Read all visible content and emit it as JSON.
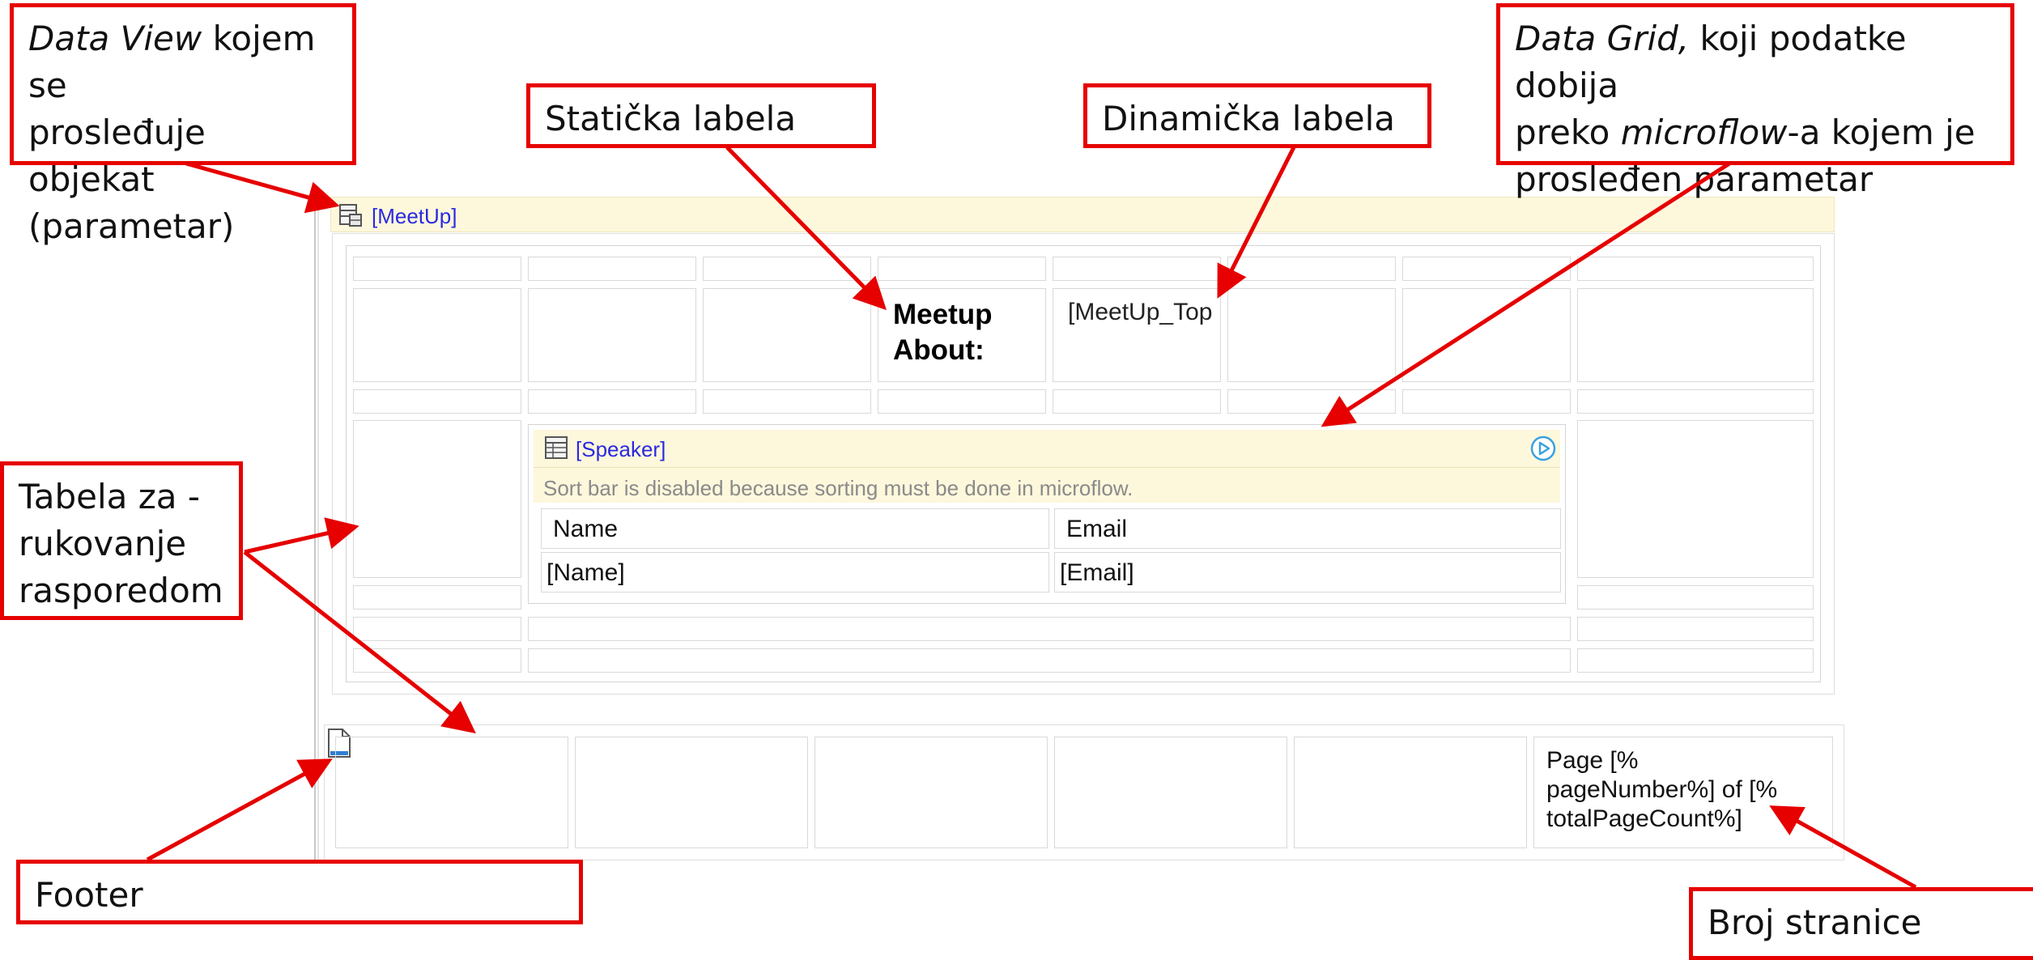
{
  "colors": {
    "callout_border": "#e60000",
    "arrow": "#e60000",
    "header_bg": "#fdf7dc",
    "entity_link": "#2a2ae0"
  },
  "dataview": {
    "entity": "[MeetUp]",
    "icon": "dataview-icon"
  },
  "layout_table": {
    "static_label": "Meetup About:",
    "dynamic_label": "[MeetUp_Topic]"
  },
  "datagrid": {
    "entity": "[Speaker]",
    "icon": "datagrid-icon",
    "run_icon": "play-circle-icon",
    "message": "Sort bar is disabled because sorting must be done in microflow.",
    "columns": [
      "Name",
      "Email"
    ],
    "row": [
      "[Name]",
      "[Email]"
    ]
  },
  "footer": {
    "icon": "page-icon",
    "page_text": "Page [% pageNumber%] of [% totalPageCount%]"
  },
  "callouts": {
    "dataview": {
      "em": "Data View",
      "rest1": " kojem se",
      "line2": "prosleđuje objekat",
      "line3": "(parametar)"
    },
    "static_label": "Statička labela",
    "dynamic_label": "Dinamička labela",
    "datagrid": {
      "em1": "Data Grid,",
      "rest1": " koji podatke dobija",
      "pre2": "preko ",
      "em2": "microflow",
      "rest2": "-a kojem je",
      "line3": "prosleđen parametar"
    },
    "layout_table": {
      "line1": "Tabela za -",
      "line2": "rukovanje",
      "line3": "rasporedom"
    },
    "footer": "Footer",
    "page_number": "Broj stranice"
  }
}
